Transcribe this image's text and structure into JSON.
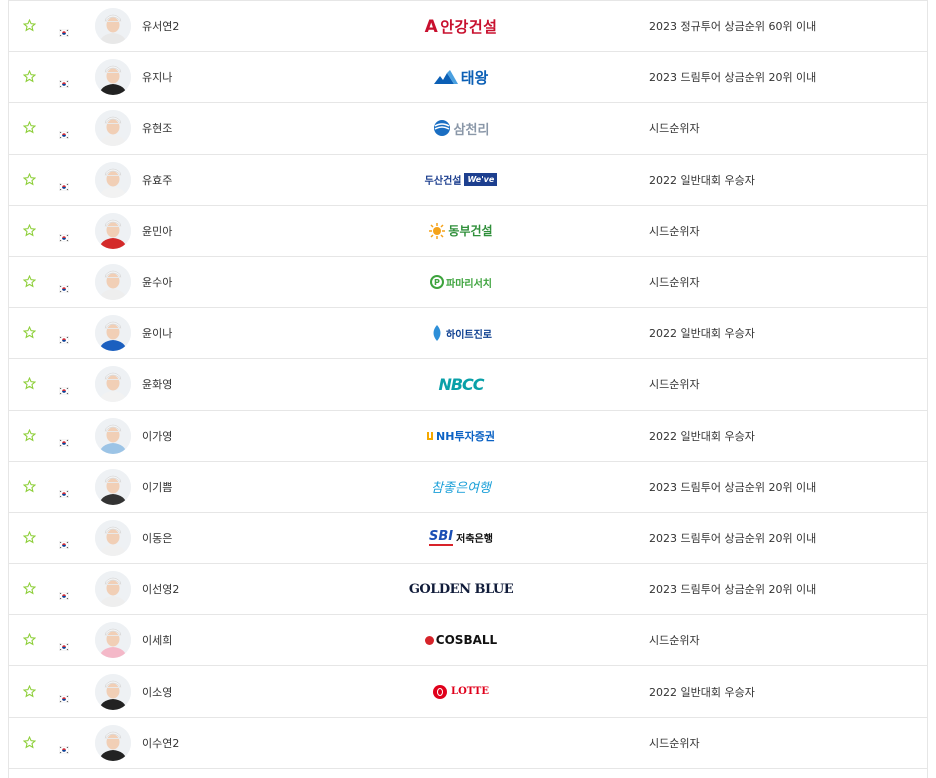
{
  "colors": {
    "star": "#8ecf3a",
    "border": "#e6e6e6",
    "text": "#333333"
  },
  "rows": [
    {
      "name": "유서연2",
      "sponsor": "안강건설",
      "sponsor_mark": "A",
      "sponsor_color": "#c8102e",
      "qualification": "2023 정규투어 상금순위 60위 이내",
      "avatar_shirt": "#e8e8e8"
    },
    {
      "name": "유지나",
      "sponsor": "태왕",
      "sponsor_mark": "",
      "sponsor_color": "#0b5fb5",
      "qualification": "2023 드림투어 상금순위 20위 이내",
      "avatar_shirt": "#222222"
    },
    {
      "name": "유현조",
      "sponsor": "삼천리",
      "sponsor_mark": "",
      "sponsor_color": "#1a6ec2",
      "qualification": "시드순위자",
      "avatar_shirt": "#f0f0f0"
    },
    {
      "name": "유효주",
      "sponsor": "두산건설",
      "sponsor_mark": "We've",
      "sponsor_color": "#1d3f8f",
      "qualification": "2022 일반대회 우승자",
      "avatar_shirt": "#f2f2f2"
    },
    {
      "name": "윤민아",
      "sponsor": "동부건설",
      "sponsor_mark": "",
      "sponsor_color": "#2f8f3a",
      "qualification": "시드순위자",
      "avatar_shirt": "#d42a2a"
    },
    {
      "name": "윤수아",
      "sponsor": "파마리서치",
      "sponsor_mark": "",
      "sponsor_color": "#3da33d",
      "qualification": "시드순위자",
      "avatar_shirt": "#eeeeee"
    },
    {
      "name": "윤이나",
      "sponsor": "하이트진로",
      "sponsor_mark": "",
      "sponsor_color": "#0a3d8f",
      "qualification": "2022 일반대회 우승자",
      "avatar_shirt": "#1b5fbf"
    },
    {
      "name": "윤화영",
      "sponsor": "NBCC",
      "sponsor_mark": "",
      "sponsor_color": "#0aa0a8",
      "qualification": "시드순위자",
      "avatar_shirt": "#f2f2f2"
    },
    {
      "name": "이가영",
      "sponsor": "NH투자증권",
      "sponsor_mark": "",
      "sponsor_color": "#0b62c4",
      "qualification": "2022 일반대회 우승자",
      "avatar_shirt": "#9cc4e6"
    },
    {
      "name": "이기쁨",
      "sponsor": "참좋은여행",
      "sponsor_mark": "",
      "sponsor_color": "#1a9fd8",
      "qualification": "2023 드림투어 상금순위 20위 이내",
      "avatar_shirt": "#333333"
    },
    {
      "name": "이동은",
      "sponsor": "저축은행",
      "sponsor_mark": "SBI",
      "sponsor_color": "#1a3a8f",
      "qualification": "2023 드림투어 상금순위 20위 이내",
      "avatar_shirt": "#f0f0f0"
    },
    {
      "name": "이선영2",
      "sponsor": "GOLDEN BLUE",
      "sponsor_mark": "",
      "sponsor_color": "#111c3a",
      "qualification": "2023 드림투어 상금순위 20위 이내",
      "avatar_shirt": "#eeeeee"
    },
    {
      "name": "이세희",
      "sponsor": "COSBALL",
      "sponsor_mark": "",
      "sponsor_color": "#111111",
      "qualification": "시드순위자",
      "avatar_shirt": "#f4b8c8"
    },
    {
      "name": "이소영",
      "sponsor": "LOTTE",
      "sponsor_mark": "",
      "sponsor_color": "#e0001b",
      "qualification": "2022 일반대회 우승자",
      "avatar_shirt": "#222222"
    },
    {
      "name": "이수연2",
      "sponsor": "",
      "sponsor_mark": "",
      "sponsor_color": "#333333",
      "qualification": "시드순위자",
      "avatar_shirt": "#222222"
    }
  ]
}
